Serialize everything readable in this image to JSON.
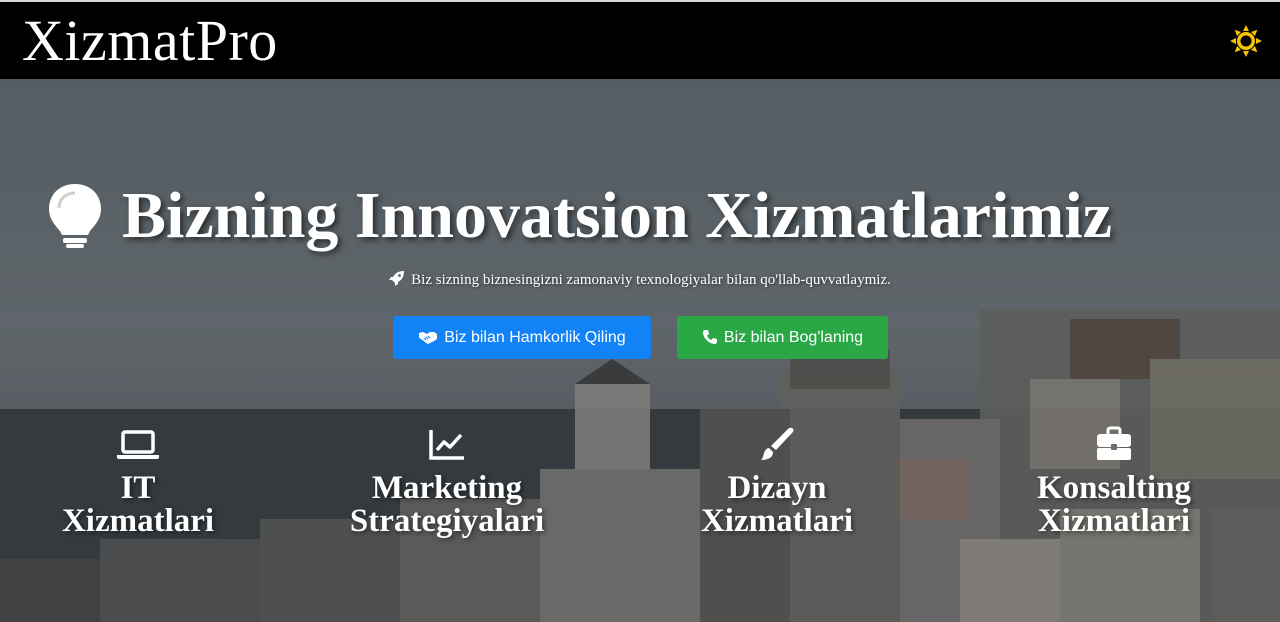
{
  "navbar": {
    "brand": "XizmatPro",
    "theme_icon": "sun-icon",
    "accent": "#f5c400"
  },
  "hero": {
    "title_icon": "lightbulb-icon",
    "title": "Bizning Innovatsion Xizmatlarimiz",
    "subtitle_icon": "rocket-icon",
    "subtitle": "Biz sizning biznesingizni zamonaviy texnologiyalar bilan qo'llab-quvvatlaymiz.",
    "buttons": [
      {
        "label": "Biz bilan Hamkorlik Qiling",
        "icon": "handshake-icon",
        "color": "#1183f6"
      },
      {
        "label": "Biz bilan Bog'laning",
        "icon": "phone-icon",
        "color": "#2aa845"
      }
    ]
  },
  "services": [
    {
      "icon": "laptop-icon",
      "line1": "IT",
      "line2": "Xizmatlari"
    },
    {
      "icon": "chart-line-icon",
      "line1": "Marketing",
      "line2": "Strategiyalari"
    },
    {
      "icon": "paintbrush-icon",
      "line1": "Dizayn",
      "line2": "Xizmatlari"
    },
    {
      "icon": "briefcase-icon",
      "line1": "Konsalting",
      "line2": "Xizmatlari"
    }
  ]
}
